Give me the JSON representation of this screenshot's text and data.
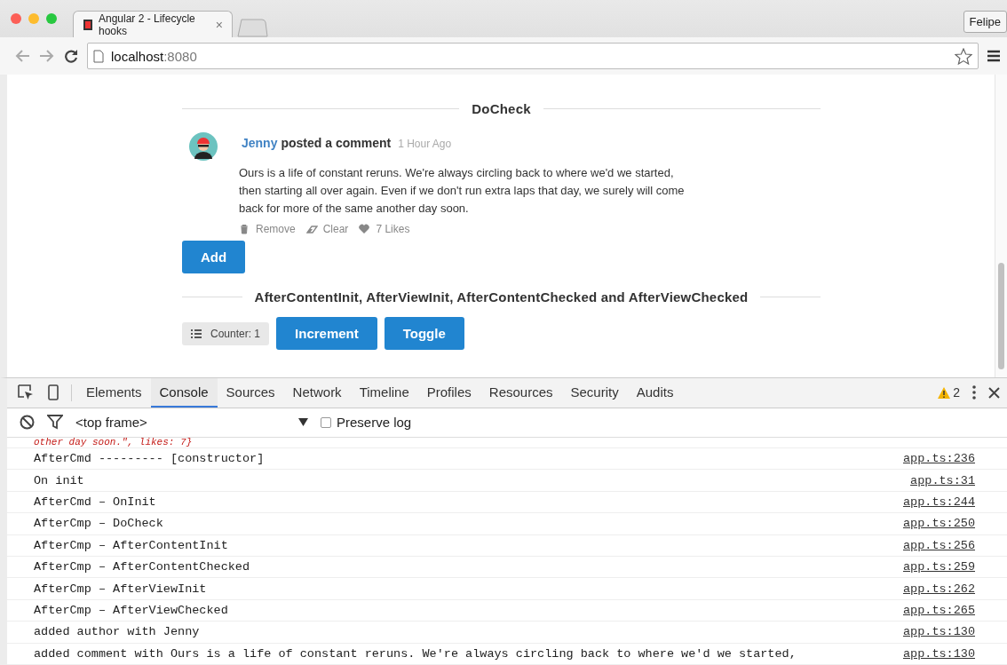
{
  "browser": {
    "tab_title": "Angular 2 - Lifecycle hooks",
    "tab_close": "×",
    "profile": "Felipe",
    "address": {
      "host": "localhost",
      "port": ":8080"
    }
  },
  "page": {
    "section1_title": "DoCheck",
    "comment": {
      "author": "Jenny",
      "action": "posted a comment",
      "time": "1 Hour Ago",
      "text": "Ours is a life of constant reruns. We're always circling back to where we'd we started, then starting all over again. Even if we don't run extra laps that day, we surely will come back for more of the same another day soon.",
      "actions": [
        {
          "kind": "remove",
          "label": "Remove"
        },
        {
          "kind": "clear",
          "label": "Clear"
        },
        {
          "kind": "like",
          "label": "7 Likes"
        }
      ]
    },
    "add_button": "Add",
    "section2_title": "AfterContentInit, AfterViewInit, AfterContentChecked and AfterViewChecked",
    "counter": "Counter: 1",
    "buttons": [
      "Increment",
      "Toggle"
    ]
  },
  "devtools": {
    "tabs": [
      {
        "label": "Elements",
        "selected": false
      },
      {
        "label": "Console",
        "selected": true
      },
      {
        "label": "Sources",
        "selected": false
      },
      {
        "label": "Network",
        "selected": false
      },
      {
        "label": "Timeline",
        "selected": false
      },
      {
        "label": "Profiles",
        "selected": false
      },
      {
        "label": "Resources",
        "selected": false
      },
      {
        "label": "Security",
        "selected": false
      },
      {
        "label": "Audits",
        "selected": false
      }
    ],
    "warnings": "2",
    "frame": "<top frame>",
    "preserve_log": {
      "label": "Preserve log",
      "checked": false
    },
    "console": [
      {
        "kind": "object",
        "text": "other day soon.\", likes: 7}"
      },
      {
        "kind": "log",
        "text": "AfterCmd --------- [constructor]",
        "source": "app.ts:236"
      },
      {
        "kind": "log",
        "text": "On init",
        "source": "app.ts:31"
      },
      {
        "kind": "log",
        "text": "AfterCmd – OnInit",
        "source": "app.ts:244"
      },
      {
        "kind": "log",
        "text": "AfterCmp – DoCheck",
        "source": "app.ts:250"
      },
      {
        "kind": "log",
        "text": "AfterCmp – AfterContentInit",
        "source": "app.ts:256"
      },
      {
        "kind": "log",
        "text": "AfterCmp – AfterContentChecked",
        "source": "app.ts:259"
      },
      {
        "kind": "log",
        "text": "AfterCmp – AfterViewInit",
        "source": "app.ts:262"
      },
      {
        "kind": "log",
        "text": "AfterCmp – AfterViewChecked",
        "source": "app.ts:265"
      },
      {
        "kind": "log",
        "text": "added author with Jenny",
        "source": "app.ts:130"
      },
      {
        "kind": "log",
        "text": "added comment with Ours is a life of constant reruns. We're always circling back to where we'd we started,",
        "source": "app.ts:130"
      }
    ]
  }
}
